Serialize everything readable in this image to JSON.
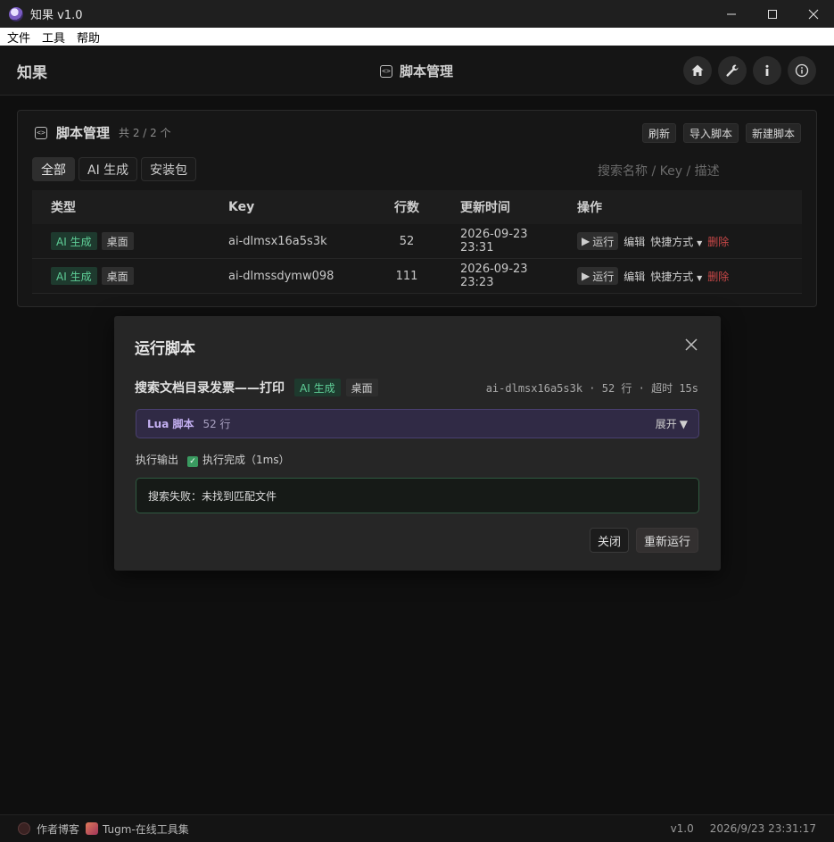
{
  "window": {
    "title": "知果 v1.0"
  },
  "menu": [
    "文件",
    "工具",
    "帮助"
  ],
  "header": {
    "brand": "知果",
    "title": "脚本管理"
  },
  "panel": {
    "title": "脚本管理",
    "count": "共 2 / 2 个",
    "actions": {
      "refresh": "刷新",
      "import": "导入脚本",
      "new": "新建脚本"
    },
    "tabs": [
      "全部",
      "AI 生成",
      "安装包"
    ],
    "search_placeholder": "搜索名称 / Key / 描述",
    "columns": {
      "type": "类型",
      "key": "Key",
      "lines": "行数",
      "updated": "更新时间",
      "ops": "操作"
    },
    "rows": [
      {
        "tag_ai": "AI 生成",
        "tag_desk": "桌面",
        "key": "ai-dlmsx16a5s3k",
        "lines": "52",
        "updated": "2026-09-23 23:31"
      },
      {
        "tag_ai": "AI 生成",
        "tag_desk": "桌面",
        "key": "ai-dlmssdymw098",
        "lines": "111",
        "updated": "2026-09-23 23:23"
      }
    ],
    "ops": {
      "run": "运行",
      "edit": "编辑",
      "shortcut": "快捷方式",
      "delete": "删除"
    }
  },
  "modal": {
    "title": "运行脚本",
    "script_name": "搜索文档目录发票——打印",
    "tag_ai": "AI 生成",
    "tag_desk": "桌面",
    "meta": "ai-dlmsx16a5s3k · 52 行 · 超时 15s",
    "lua_label": "Lua 脚本",
    "lua_lines": "52 行",
    "expand": "展开",
    "output_label": "执行输出",
    "status": "执行完成（1ms）",
    "output_text": "搜索失败：未找到匹配文件",
    "close": "关闭",
    "rerun": "重新运行"
  },
  "footer": {
    "blog": "作者博客",
    "tools": "Tugm-在线工具集",
    "version": "v1.0",
    "datetime": "2026/9/23 23:31:17"
  }
}
